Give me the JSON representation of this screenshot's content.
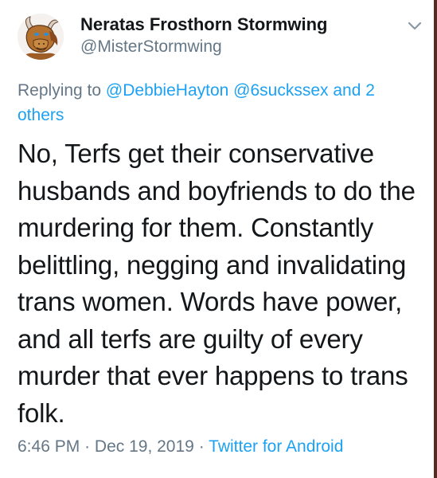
{
  "user": {
    "display_name": "Neratas Frosthorn Stormwing",
    "handle": "@MisterStormwing",
    "avatar_icon": "dragon-avatar-icon"
  },
  "reply": {
    "prefix": "Replying to",
    "mention_1": "@DebbieHayton",
    "mention_2": "@6suckssex",
    "and_text": "and 2",
    "others": "others"
  },
  "tweet": {
    "lines": [
      "No, Terfs get their conservative",
      "husbands and boyfriends to do the",
      "murdering for them. Constantly",
      "belittling, negging and invalidating",
      "trans women. Words have power,",
      "and all terfs are guilty of every",
      "murder that ever happens to trans",
      "folk."
    ]
  },
  "meta": {
    "time": "6:46 PM",
    "separator_1": "·",
    "date": "Dec 19, 2019",
    "separator_2": "·",
    "source": "Twitter for Android"
  },
  "colors": {
    "accent": "#1da1f2",
    "text": "#14171a",
    "secondary": "#657786"
  }
}
